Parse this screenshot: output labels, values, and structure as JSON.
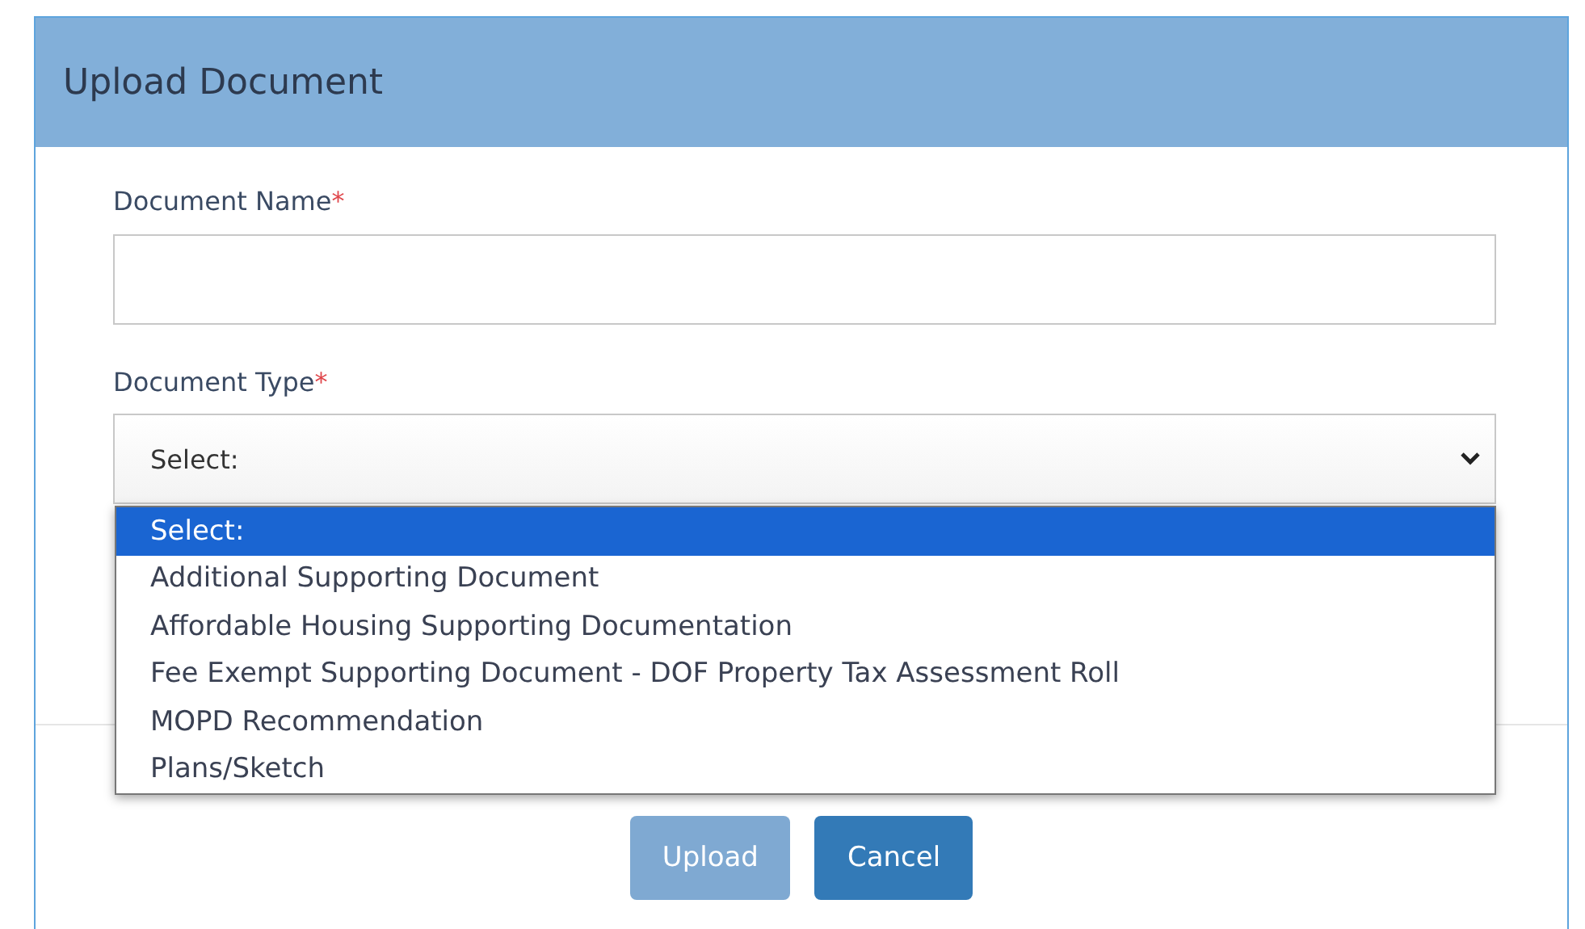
{
  "dialog": {
    "title": "Upload Document"
  },
  "fields": [
    {
      "kind": "text",
      "label": "Document Name",
      "required_mark": "*"
    },
    {
      "kind": "select",
      "label": "Document Type",
      "required_mark": "*",
      "value": "Select:",
      "expanded": true,
      "options": [
        {
          "label": "Select:",
          "selected": true
        },
        {
          "label": "Additional Supporting Document",
          "selected": false
        },
        {
          "label": "Affordable Housing Supporting Documentation",
          "selected": false
        },
        {
          "label": "Fee Exempt Supporting Document - DOF Property Tax Assessment Roll",
          "selected": false
        },
        {
          "label": "MOPD Recommendation",
          "selected": false
        },
        {
          "label": "Plans/Sketch",
          "selected": false
        }
      ]
    }
  ],
  "buttons": [
    {
      "label": "Upload",
      "disabled": true
    },
    {
      "label": "Cancel",
      "disabled": false
    }
  ]
}
